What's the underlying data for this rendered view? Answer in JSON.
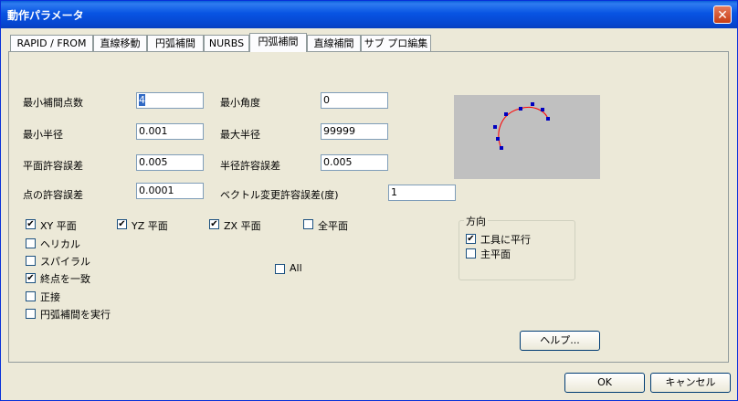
{
  "window": {
    "title": "動作パラメータ"
  },
  "tabs": [
    {
      "label": "RAPID / FROM"
    },
    {
      "label": "直線移動"
    },
    {
      "label": "円弧補間"
    },
    {
      "label": "NURBS"
    },
    {
      "label": "円弧補間"
    },
    {
      "label": "直線補間"
    },
    {
      "label": "サブ プロ編集"
    }
  ],
  "active_tab_index": 4,
  "fields": {
    "min_interp_points": {
      "label": "最小補間点数",
      "value": "4"
    },
    "min_angle": {
      "label": "最小角度",
      "value": "0"
    },
    "min_radius": {
      "label": "最小半径",
      "value": "0.001"
    },
    "max_radius": {
      "label": "最大半径",
      "value": "99999"
    },
    "plane_tolerance": {
      "label": "平面許容誤差",
      "value": "0.005"
    },
    "radius_tolerance": {
      "label": "半径許容誤差",
      "value": "0.005"
    },
    "point_tolerance": {
      "label": "点の許容誤差",
      "value": "0.0001"
    },
    "vector_tolerance": {
      "label": "ベクトル変更許容誤差(度)",
      "value": "1"
    }
  },
  "planes": [
    {
      "label": "XY 平面",
      "checked": true
    },
    {
      "label": "YZ 平面",
      "checked": true
    },
    {
      "label": "ZX 平面",
      "checked": true
    },
    {
      "label": "全平面",
      "checked": false
    }
  ],
  "options": [
    {
      "label": "ヘリカル",
      "checked": false
    },
    {
      "label": "スパイラル",
      "checked": false
    },
    {
      "label": "終点を一致",
      "checked": true
    },
    {
      "label": "正接",
      "checked": false
    },
    {
      "label": "円弧補間を実行",
      "checked": false
    }
  ],
  "all_checkbox": {
    "label": "All",
    "checked": false
  },
  "direction": {
    "title": "方向",
    "items": [
      {
        "label": "工具に平行",
        "checked": true
      },
      {
        "label": "主平面",
        "checked": false
      }
    ]
  },
  "buttons": {
    "help": "ヘルプ...",
    "ok": "OK",
    "cancel": "キャンセル"
  },
  "check_mark": "✔"
}
